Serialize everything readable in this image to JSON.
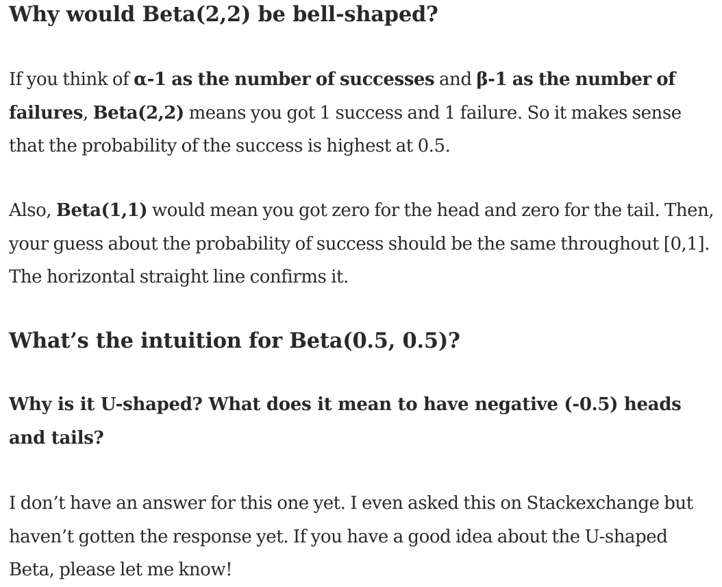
{
  "section1": {
    "heading": "Why would Beta(2,2) be bell-shaped?",
    "p1": {
      "t1": "If you think of ",
      "b1": "α-1 as the number of successes",
      "t2": " and ",
      "b2": "β-1 as the number of failures",
      "t3": ", ",
      "b3": "Beta(2,2)",
      "t4": " means you got 1 success and 1 failure. So it makes sense that the probability of the success is highest at 0.5."
    },
    "p2": {
      "t1": "Also, ",
      "b1": "Beta(1,1)",
      "t2": " would mean you got zero for the head and zero for the tail. Then, your guess about the probability of success should be the same throughout [0,1]. The horizontal straight line confirms it."
    }
  },
  "section2": {
    "heading": "What’s the intuition for Beta(0.5, 0.5)?",
    "subheading": "Why is it U-shaped? What does it mean to have negative (-0.5) heads and tails?",
    "p3": "I don’t have an answer for this one yet. I even asked this on Stackexchange but haven’t gotten the response yet. If you have a good idea about the U-shaped Beta, please let me know!"
  }
}
